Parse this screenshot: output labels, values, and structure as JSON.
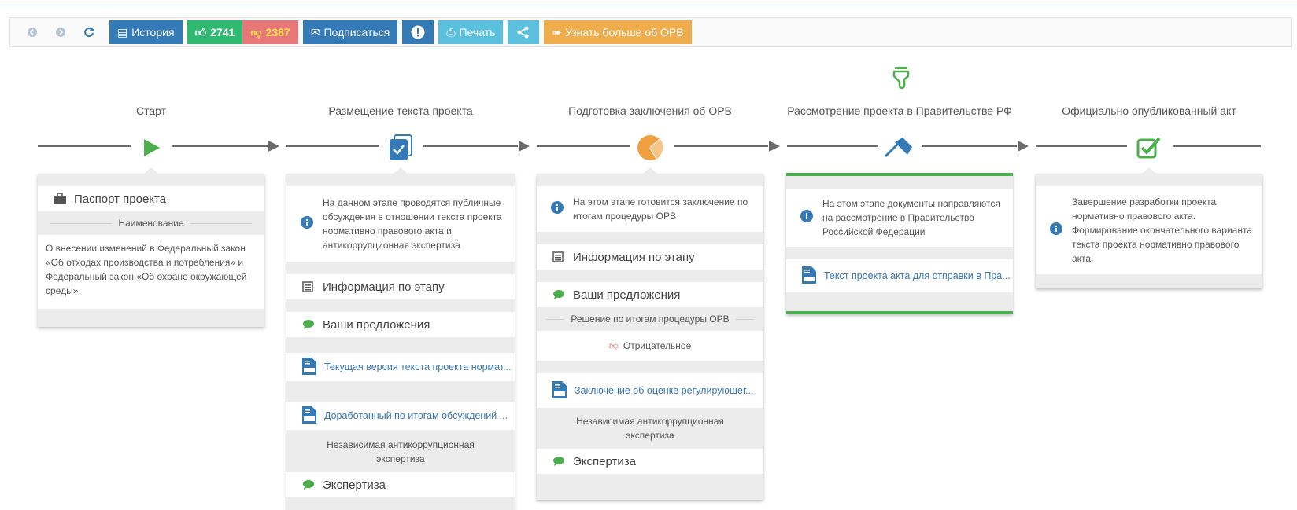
{
  "toolbar": {
    "history_label": "История",
    "likes": "2741",
    "dislikes": "2387",
    "subscribe_label": "Подписаться",
    "print_label": "Печать",
    "learn_more_label": "Узнать больше об ОРВ"
  },
  "stages": [
    {
      "title": "Старт"
    },
    {
      "title": "Размещение текста проекта"
    },
    {
      "title": "Подготовка заключения об ОРВ"
    },
    {
      "title": "Рассмотрение проекта в Правительстве РФ"
    },
    {
      "title": "Официально опубликованный акт"
    }
  ],
  "card1": {
    "passport_label": "Паспорт проекта",
    "name_label": "Наименование",
    "description": "О внесении изменений в Федеральный закон «Об отходах производства и потребления» и Федеральный закон «Об охране окружающей среды»"
  },
  "card2": {
    "info": "На данном этапе проводятся публичные обсуждения в отношении текста проекта нормативно правового акта и антикоррупционная экспертиза",
    "stage_info_label": "Информация по этапу",
    "proposals_label": "Ваши предложения",
    "doc1": "Текущая версия текста проекта нормат...",
    "doc2": "Доработанный по итогам обсуждений ...",
    "expertise_header": "Независимая антикоррупционная экспертиза",
    "expertise_label": "Экспертиза"
  },
  "card3": {
    "info": "На этом этапе готовится заключение по итогам процедуры ОРВ",
    "stage_info_label": "Информация по этапу",
    "proposals_label": "Ваши предложения",
    "decision_header": "Решение по итогам процедуры ОРВ",
    "decision_value": "Отрицательное",
    "doc1": "Заключение об оценке регулирующег...",
    "expertise_header": "Независимая антикоррупционная экспертиза",
    "expertise_label": "Экспертиза"
  },
  "card4": {
    "info": "На этом этапе документы направляются на рассмотрение в Правительство Российской Федерации",
    "doc1": "Текст проекта акта для отправки в Пра..."
  },
  "card5": {
    "info": "Завершение разработки проекта нормативно правового акта. Формирование окончательного варианта текста проекта нормативно правового акта."
  },
  "colors": {
    "primary": "#337ab7",
    "success": "#2fb86f",
    "danger": "#e8777a",
    "info": "#5bc0de",
    "warning": "#f0ad4e",
    "stage_green": "#4cae4c",
    "stage_orange": "#f0a040"
  },
  "icons": {
    "back": "circle-arrow-left-icon",
    "forward": "circle-arrow-right-icon",
    "refresh": "refresh-icon",
    "history": "list-icon",
    "like": "thumbs-up-icon",
    "dislike": "thumbs-down-icon",
    "subscribe": "envelope-icon",
    "warning": "exclamation-icon",
    "print": "print-icon",
    "share": "share-icon",
    "learn_more": "sign-in-icon"
  }
}
